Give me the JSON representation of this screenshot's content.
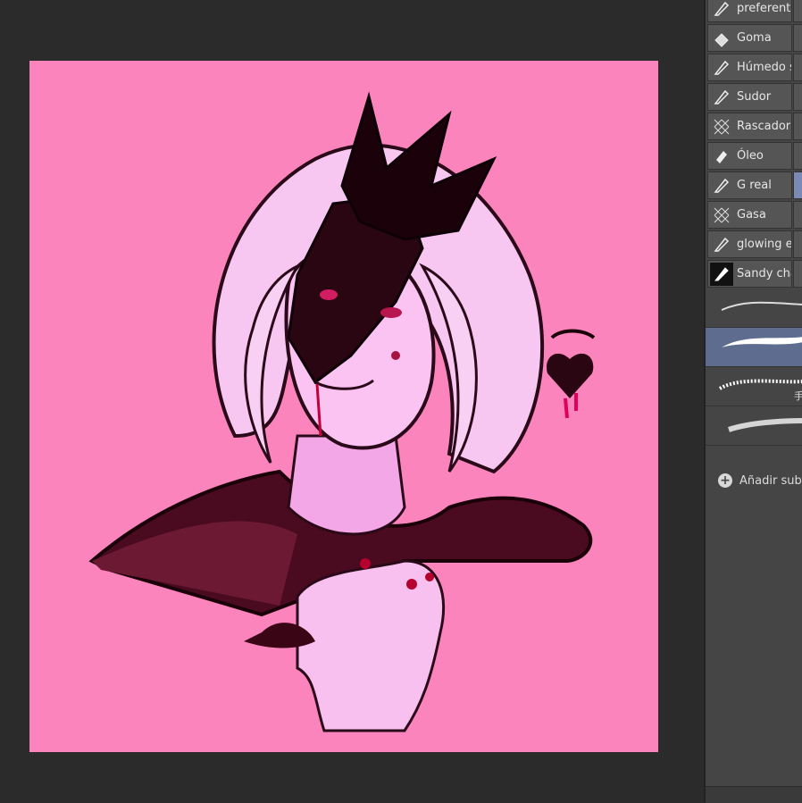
{
  "canvas": {
    "background": "#fb84bd",
    "artwork": "illustration"
  },
  "brush_panel": {
    "items": [
      {
        "label": "preferente",
        "icon": "pen-nib-icon"
      },
      {
        "label": "Goma",
        "icon": "eraser-icon"
      },
      {
        "label": "Húmedo s",
        "icon": "pen-nib-icon"
      },
      {
        "label": "Sudor",
        "icon": "pen-nib-icon"
      },
      {
        "label": "Rascador",
        "icon": "crosshatch-icon"
      },
      {
        "label": "Óleo",
        "icon": "paint-tube-icon"
      },
      {
        "label": "G real",
        "icon": "pen-nib-icon"
      },
      {
        "label": "Gasa",
        "icon": "crosshatch-icon"
      },
      {
        "label": "glowing ef",
        "icon": "pen-nib-icon"
      },
      {
        "label": "Sandy cha",
        "icon": "pen-nib-dark-icon"
      }
    ],
    "strokes": [
      {
        "name": "stroke-preview-1",
        "tag": ""
      },
      {
        "name": "stroke-preview-2",
        "tag": ""
      },
      {
        "name": "stroke-preview-3",
        "tag": "手"
      },
      {
        "name": "stroke-preview-4",
        "tag": ""
      }
    ],
    "add_subtool_label": "Añadir subh"
  },
  "colors": {
    "workspace": "#2b2b2b",
    "panel": "#454545",
    "selected": "#5d6c8f",
    "highlight": "#7a89b6"
  }
}
